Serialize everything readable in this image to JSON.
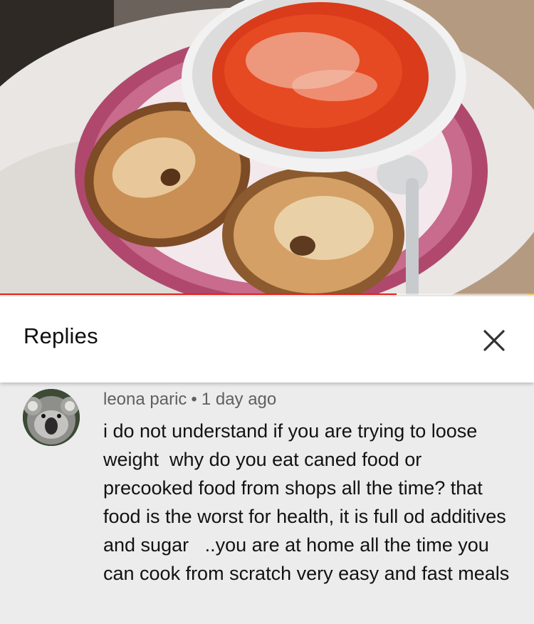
{
  "video": {
    "thumbnail_icon": "video-frame-soup-and-bagel",
    "progress_fraction": 0.742,
    "progress_color": "#e62117"
  },
  "replies_panel": {
    "title": "Replies",
    "close_icon": "close-icon"
  },
  "comment": {
    "author": "leona paric",
    "separator": "•",
    "time": "1 day ago",
    "avatar_icon": "koala-avatar",
    "text": "i do not understand if you are trying to loose weight  why do you eat caned food or precooked food from shops all the time? that food is the worst for health, it is full od additives and sugar   ..you are at home all the time you can cook from scratch very easy and fast meals"
  }
}
